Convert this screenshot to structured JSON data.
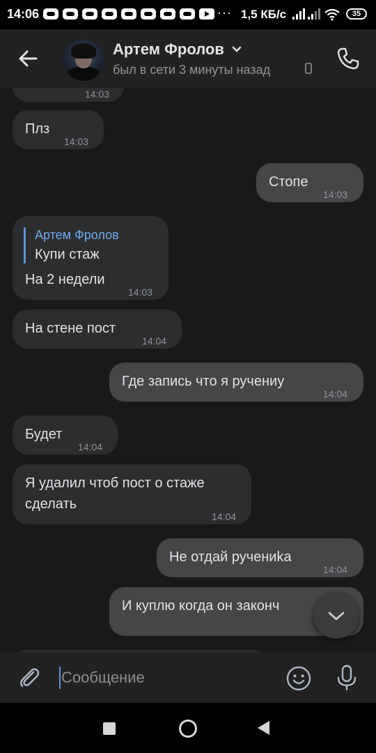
{
  "status_bar": {
    "time": "14:06",
    "dots": "···",
    "speed": "1,5 КБ/с",
    "battery": "35"
  },
  "header": {
    "name": "Артем Фролов",
    "status": "был в сети 3 минуты назад"
  },
  "messages": [
    {
      "dir": "in",
      "text": "",
      "time": "14:03"
    },
    {
      "dir": "in",
      "text": "Плз",
      "time": "14:03"
    },
    {
      "dir": "out",
      "text": "Стопе",
      "time": "14:03"
    },
    {
      "dir": "in",
      "reply_author": "Артем Фролов",
      "reply_text": "Купи стаж",
      "text": "На 2 недели",
      "time": "14:03"
    },
    {
      "dir": "in",
      "text": "На стене пост",
      "time": "14:04"
    },
    {
      "dir": "out",
      "text": "Где запись что я ручениу",
      "time": "14:04"
    },
    {
      "dir": "in",
      "text": "Будет",
      "time": "14:04"
    },
    {
      "dir": "in",
      "lines": [
        "Я удалил чтоб пост о стаже",
        "сделать"
      ],
      "time": "14:04"
    },
    {
      "dir": "out",
      "text": "Не отдай ручениka",
      "time": "14:04"
    },
    {
      "dir": "out",
      "text": "И куплю когда он законч",
      "time": ""
    }
  ],
  "composer": {
    "placeholder": "Сообщение"
  },
  "colors": {
    "background": "#19191a",
    "incoming_bubble": "#2c2d2e",
    "outgoing_bubble": "#454647",
    "accent": "#71aaeb"
  },
  "icons": [
    "back-arrow-icon",
    "chevron-down-icon",
    "mobile-phone-icon",
    "call-icon",
    "chevron-down-icon",
    "paperclip-icon",
    "emoji-icon",
    "microphone-icon"
  ]
}
